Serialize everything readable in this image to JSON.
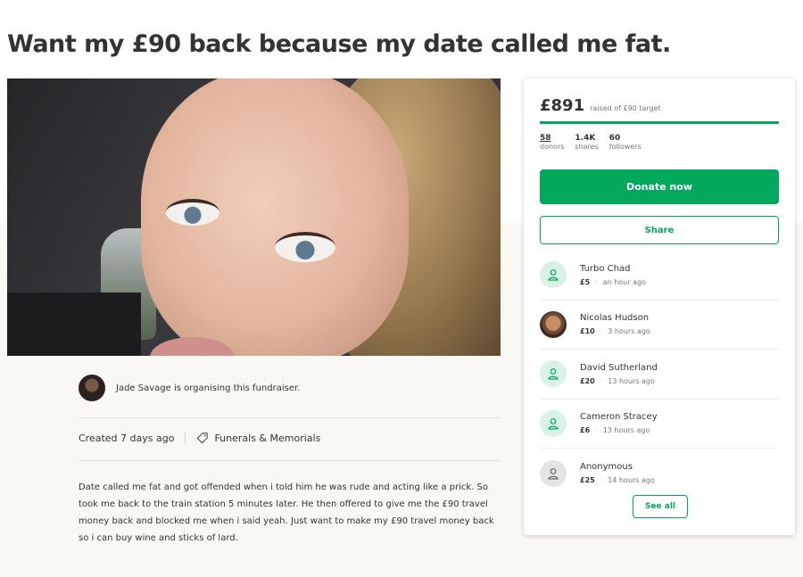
{
  "campaign": {
    "title": "Want my £90 back because my date called me fat.",
    "organiser_text": "Jade Savage is organising this fundraiser.",
    "created": "Created 7 days ago",
    "category": "Funerals & Memorials",
    "description": "Date called me fat and got offended when i told him he was rude and acting like a prick. So took me back to the train station 5 minutes later. He then offered to give me the £90 travel money back and blocked me when i said yeah. Just want to make my £90 travel money back so i can buy wine and sticks of lard."
  },
  "sidebar": {
    "raised_amount": "£891",
    "raised_sub": "raised of £90 target",
    "progress_fraction": 1.0,
    "stats": [
      {
        "number": "58",
        "label": "donors"
      },
      {
        "number": "1.4K",
        "label": "shares"
      },
      {
        "number": "60",
        "label": "followers"
      }
    ],
    "donate_label": "Donate now",
    "share_label": "Share",
    "see_all_label": "See all",
    "donations": [
      {
        "name": "Turbo Chad",
        "amount": "£5",
        "time": "an hour ago",
        "avatar": "user-icon"
      },
      {
        "name": "Nicolas Hudson",
        "amount": "£10",
        "time": "3 hours ago",
        "avatar": "photo"
      },
      {
        "name": "David Sutherland",
        "amount": "£20",
        "time": "13 hours ago",
        "avatar": "user-icon"
      },
      {
        "name": "Cameron Stracey",
        "amount": "£6",
        "time": "13 hours ago",
        "avatar": "user-icon"
      },
      {
        "name": "Anonymous",
        "amount": "£25",
        "time": "14 hours ago",
        "avatar": "user-icon-grey"
      }
    ]
  },
  "colors": {
    "accent": "#02a95c",
    "avatar_green_bg": "#d9f2e6"
  }
}
